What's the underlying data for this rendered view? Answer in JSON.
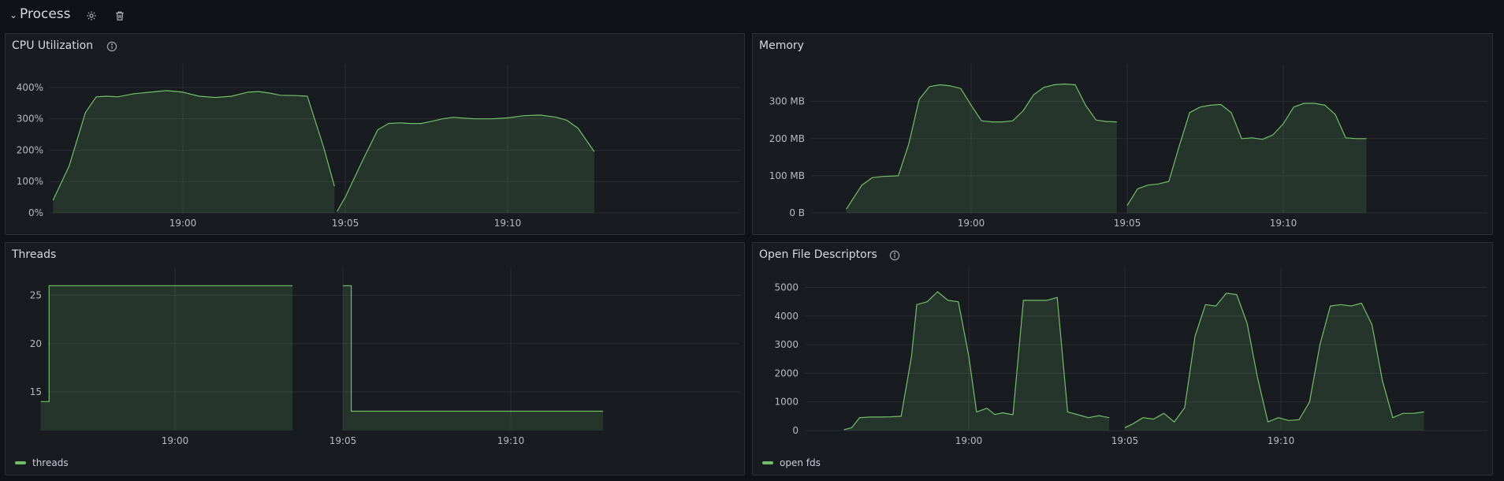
{
  "row": {
    "title": "Process",
    "icons": [
      "chevron-down-icon",
      "gear-icon",
      "trash-icon"
    ]
  },
  "colors": {
    "series": "#73bf69",
    "grid": "#2a2d33"
  },
  "panels": {
    "cpu": {
      "title": "CPU Utilization",
      "has_info": true
    },
    "memory": {
      "title": "Memory",
      "has_info": false
    },
    "threads": {
      "title": "Threads",
      "has_info": false,
      "legend": "threads"
    },
    "fds": {
      "title": "Open File Descriptors",
      "has_info": true,
      "legend": "open fds"
    }
  },
  "chart_data": [
    {
      "id": "cpu",
      "type": "area",
      "title": "CPU Utilization",
      "x_unit": "minutes",
      "xlim": [
        "18:56:00",
        "19:12:45"
      ],
      "x_ticks": [
        "19:00",
        "19:05",
        "19:10"
      ],
      "y_ticks": [
        "0%",
        "100%",
        "200%",
        "300%",
        "400%"
      ],
      "ylim": [
        0,
        450
      ],
      "series": [
        {
          "segments": [
            [
              [
                "18:56:00",
                40
              ],
              [
                "18:56:30",
                150
              ],
              [
                "18:57:00",
                320
              ],
              [
                "18:57:20",
                370
              ],
              [
                "18:57:40",
                372
              ],
              [
                "18:58:00",
                370
              ],
              [
                "18:58:30",
                380
              ],
              [
                "18:59:00",
                385
              ],
              [
                "18:59:30",
                390
              ],
              [
                "19:00:00",
                385
              ],
              [
                "19:00:30",
                372
              ],
              [
                "19:01:00",
                368
              ],
              [
                "19:01:30",
                372
              ],
              [
                "19:02:00",
                385
              ],
              [
                "19:02:20",
                387
              ],
              [
                "19:02:40",
                382
              ],
              [
                "19:03:00",
                375
              ],
              [
                "19:03:30",
                374
              ],
              [
                "19:03:50",
                372
              ],
              [
                "19:04:20",
                210
              ],
              [
                "19:04:40",
                85
              ]
            ],
            [
              [
                "19:04:45",
                5
              ],
              [
                "19:05:00",
                50
              ],
              [
                "19:05:30",
                160
              ],
              [
                "19:06:00",
                265
              ],
              [
                "19:06:20",
                285
              ],
              [
                "19:06:40",
                287
              ],
              [
                "19:07:00",
                285
              ],
              [
                "19:07:20",
                285
              ],
              [
                "19:07:40",
                292
              ],
              [
                "19:08:00",
                300
              ],
              [
                "19:08:20",
                305
              ],
              [
                "19:08:40",
                302
              ],
              [
                "19:09:00",
                300
              ],
              [
                "19:09:30",
                300
              ],
              [
                "19:10:00",
                303
              ],
              [
                "19:10:30",
                310
              ],
              [
                "19:11:00",
                312
              ],
              [
                "19:11:30",
                305
              ],
              [
                "19:11:50",
                295
              ],
              [
                "19:12:10",
                270
              ],
              [
                "19:12:40",
                195
              ]
            ]
          ]
        }
      ]
    },
    {
      "id": "memory",
      "type": "area",
      "title": "Memory",
      "x_unit": "minutes",
      "xlim": [
        "18:56:00",
        "19:12:45"
      ],
      "x_ticks": [
        "19:00",
        "19:05",
        "19:10"
      ],
      "y_ticks": [
        "0 B",
        "100 MB",
        "200 MB",
        "300 MB"
      ],
      "ylim": [
        0,
        380
      ],
      "series": [
        {
          "segments": [
            [
              [
                "18:56:00",
                10
              ],
              [
                "18:56:30",
                75
              ],
              [
                "18:56:50",
                95
              ],
              [
                "18:57:10",
                98
              ],
              [
                "18:57:40",
                100
              ],
              [
                "18:58:00",
                185
              ],
              [
                "18:58:20",
                305
              ],
              [
                "18:58:40",
                340
              ],
              [
                "18:59:00",
                345
              ],
              [
                "18:59:20",
                342
              ],
              [
                "18:59:40",
                335
              ],
              [
                "19:00:00",
                290
              ],
              [
                "19:00:20",
                248
              ],
              [
                "19:00:40",
                245
              ],
              [
                "19:01:00",
                245
              ],
              [
                "19:01:20",
                248
              ],
              [
                "19:01:40",
                275
              ],
              [
                "19:02:00",
                318
              ],
              [
                "19:02:20",
                338
              ],
              [
                "19:02:40",
                345
              ],
              [
                "19:03:00",
                347
              ],
              [
                "19:03:20",
                345
              ],
              [
                "19:03:40",
                290
              ],
              [
                "19:04:00",
                250
              ],
              [
                "19:04:20",
                246
              ],
              [
                "19:04:40",
                245
              ]
            ],
            [
              [
                "19:05:00",
                20
              ],
              [
                "19:05:20",
                65
              ],
              [
                "19:05:40",
                75
              ],
              [
                "19:06:00",
                78
              ],
              [
                "19:06:20",
                85
              ],
              [
                "19:06:40",
                180
              ],
              [
                "19:07:00",
                270
              ],
              [
                "19:07:20",
                285
              ],
              [
                "19:07:40",
                290
              ],
              [
                "19:08:00",
                292
              ],
              [
                "19:08:20",
                270
              ],
              [
                "19:08:40",
                200
              ],
              [
                "19:09:00",
                202
              ],
              [
                "19:09:20",
                198
              ],
              [
                "19:09:40",
                210
              ],
              [
                "19:10:00",
                240
              ],
              [
                "19:10:20",
                285
              ],
              [
                "19:10:40",
                295
              ],
              [
                "19:11:00",
                295
              ],
              [
                "19:11:20",
                290
              ],
              [
                "19:11:40",
                265
              ],
              [
                "19:12:00",
                202
              ],
              [
                "19:12:20",
                200
              ],
              [
                "19:12:40",
                200
              ]
            ]
          ]
        }
      ]
    },
    {
      "id": "threads",
      "type": "area",
      "title": "Threads",
      "x_unit": "minutes",
      "xlim": [
        "18:56:00",
        "19:12:45"
      ],
      "x_ticks": [
        "19:00",
        "19:05",
        "19:10"
      ],
      "y_ticks": [
        "15",
        "20",
        "25"
      ],
      "ylim": [
        11,
        27
      ],
      "step": true,
      "series": [
        {
          "name": "threads",
          "segments": [
            [
              [
                "18:56:00",
                14
              ],
              [
                "18:56:15",
                14
              ],
              [
                "18:56:15",
                26
              ],
              [
                "19:03:30",
                26
              ]
            ],
            [
              [
                "19:05:00",
                26
              ],
              [
                "19:05:15",
                26
              ],
              [
                "19:05:15",
                13
              ],
              [
                "19:12:45",
                13
              ]
            ]
          ]
        }
      ]
    },
    {
      "id": "fds",
      "type": "area",
      "title": "Open File Descriptors",
      "x_unit": "minutes",
      "xlim": [
        "18:56:00",
        "19:12:45"
      ],
      "x_ticks": [
        "19:00",
        "19:05",
        "19:10"
      ],
      "y_ticks": [
        "0",
        "1000",
        "2000",
        "3000",
        "4000",
        "5000"
      ],
      "ylim": [
        0,
        5400
      ],
      "series": [
        {
          "name": "open fds",
          "segments": [
            [
              [
                "18:56:00",
                30
              ],
              [
                "18:56:15",
                100
              ],
              [
                "18:56:30",
                450
              ],
              [
                "18:56:50",
                470
              ],
              [
                "18:57:10",
                470
              ],
              [
                "18:57:30",
                480
              ],
              [
                "18:57:50",
                500
              ],
              [
                "18:58:10",
                2600
              ],
              [
                "18:58:20",
                4400
              ],
              [
                "18:58:40",
                4500
              ],
              [
                "18:59:00",
                4850
              ],
              [
                "18:59:20",
                4550
              ],
              [
                "18:59:40",
                4500
              ],
              [
                "19:00:00",
                2600
              ],
              [
                "19:00:15",
                650
              ],
              [
                "19:00:35",
                780
              ],
              [
                "19:00:50",
                560
              ],
              [
                "19:01:05",
                620
              ],
              [
                "19:01:25",
                550
              ],
              [
                "19:01:45",
                4550
              ],
              [
                "19:02:05",
                4550
              ],
              [
                "19:02:30",
                4550
              ],
              [
                "19:02:50",
                4650
              ],
              [
                "19:03:10",
                650
              ],
              [
                "19:03:30",
                550
              ],
              [
                "19:03:50",
                450
              ],
              [
                "19:04:10",
                520
              ],
              [
                "19:04:30",
                450
              ]
            ],
            [
              [
                "19:05:00",
                100
              ],
              [
                "19:05:15",
                230
              ],
              [
                "19:05:35",
                450
              ],
              [
                "19:05:55",
                400
              ],
              [
                "19:06:15",
                600
              ],
              [
                "19:06:35",
                300
              ],
              [
                "19:06:55",
                800
              ],
              [
                "19:07:15",
                3300
              ],
              [
                "19:07:35",
                4400
              ],
              [
                "19:07:55",
                4350
              ],
              [
                "19:08:15",
                4800
              ],
              [
                "19:08:35",
                4750
              ],
              [
                "19:08:55",
                3750
              ],
              [
                "19:09:15",
                1850
              ],
              [
                "19:09:35",
                300
              ],
              [
                "19:09:55",
                450
              ],
              [
                "19:10:15",
                350
              ],
              [
                "19:10:35",
                380
              ],
              [
                "19:10:55",
                1000
              ],
              [
                "19:11:15",
                3000
              ],
              [
                "19:11:35",
                4350
              ],
              [
                "19:11:55",
                4400
              ],
              [
                "19:12:15",
                4350
              ],
              [
                "19:12:35",
                4450
              ],
              [
                "19:12:55",
                3700
              ],
              [
                "19:13:15",
                1750
              ],
              [
                "19:13:35",
                450
              ],
              [
                "19:13:55",
                600
              ],
              [
                "19:14:15",
                600
              ],
              [
                "19:14:35",
                650
              ]
            ]
          ]
        }
      ]
    }
  ]
}
